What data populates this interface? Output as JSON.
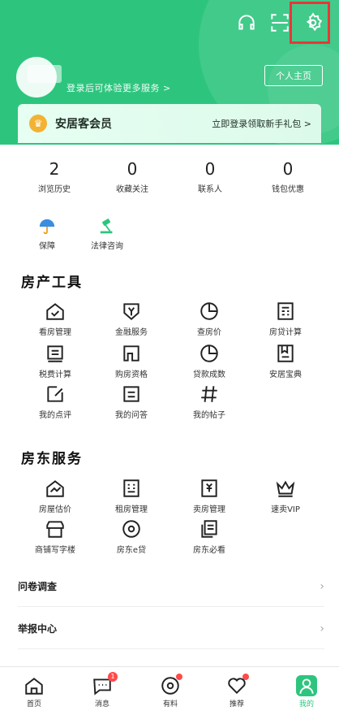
{
  "header": {
    "login_hint": "登录后可体验更多服务 >",
    "profile_button": "个人主页",
    "icons": [
      "headset-icon",
      "scan-icon",
      "settings-icon"
    ],
    "accent": "#2dc57e"
  },
  "member": {
    "title": "安居客会员",
    "cta": "立即登录领取新手礼包 >"
  },
  "stats": [
    {
      "num": "2",
      "label": "浏览历史"
    },
    {
      "num": "0",
      "label": "收藏关注"
    },
    {
      "num": "0",
      "label": "联系人"
    },
    {
      "num": "0",
      "label": "钱包优惠"
    }
  ],
  "mini": [
    {
      "label": "保障"
    },
    {
      "label": "法律咨询"
    }
  ],
  "tools": {
    "title": "房产工具",
    "items": [
      {
        "label": "看房管理"
      },
      {
        "label": "金融服务"
      },
      {
        "label": "查房价"
      },
      {
        "label": "房贷计算"
      },
      {
        "label": "税费计算"
      },
      {
        "label": "购房资格"
      },
      {
        "label": "贷款成数"
      },
      {
        "label": "安居宝典"
      },
      {
        "label": "我的点评"
      },
      {
        "label": "我的问答"
      },
      {
        "label": "我的帖子"
      }
    ]
  },
  "landlord": {
    "title": "房东服务",
    "items": [
      {
        "label": "房屋估价"
      },
      {
        "label": "租房管理"
      },
      {
        "label": "卖房管理"
      },
      {
        "label": "速卖VIP"
      },
      {
        "label": "商铺写字楼"
      },
      {
        "label": "房东e贷"
      },
      {
        "label": "房东必看"
      }
    ]
  },
  "rows": [
    {
      "label": "问卷调查"
    },
    {
      "label": "举报中心"
    }
  ],
  "bottom_nav": [
    {
      "label": "首页"
    },
    {
      "label": "消息",
      "badge": "1"
    },
    {
      "label": "有料"
    },
    {
      "label": "推荐"
    },
    {
      "label": "我的"
    }
  ]
}
